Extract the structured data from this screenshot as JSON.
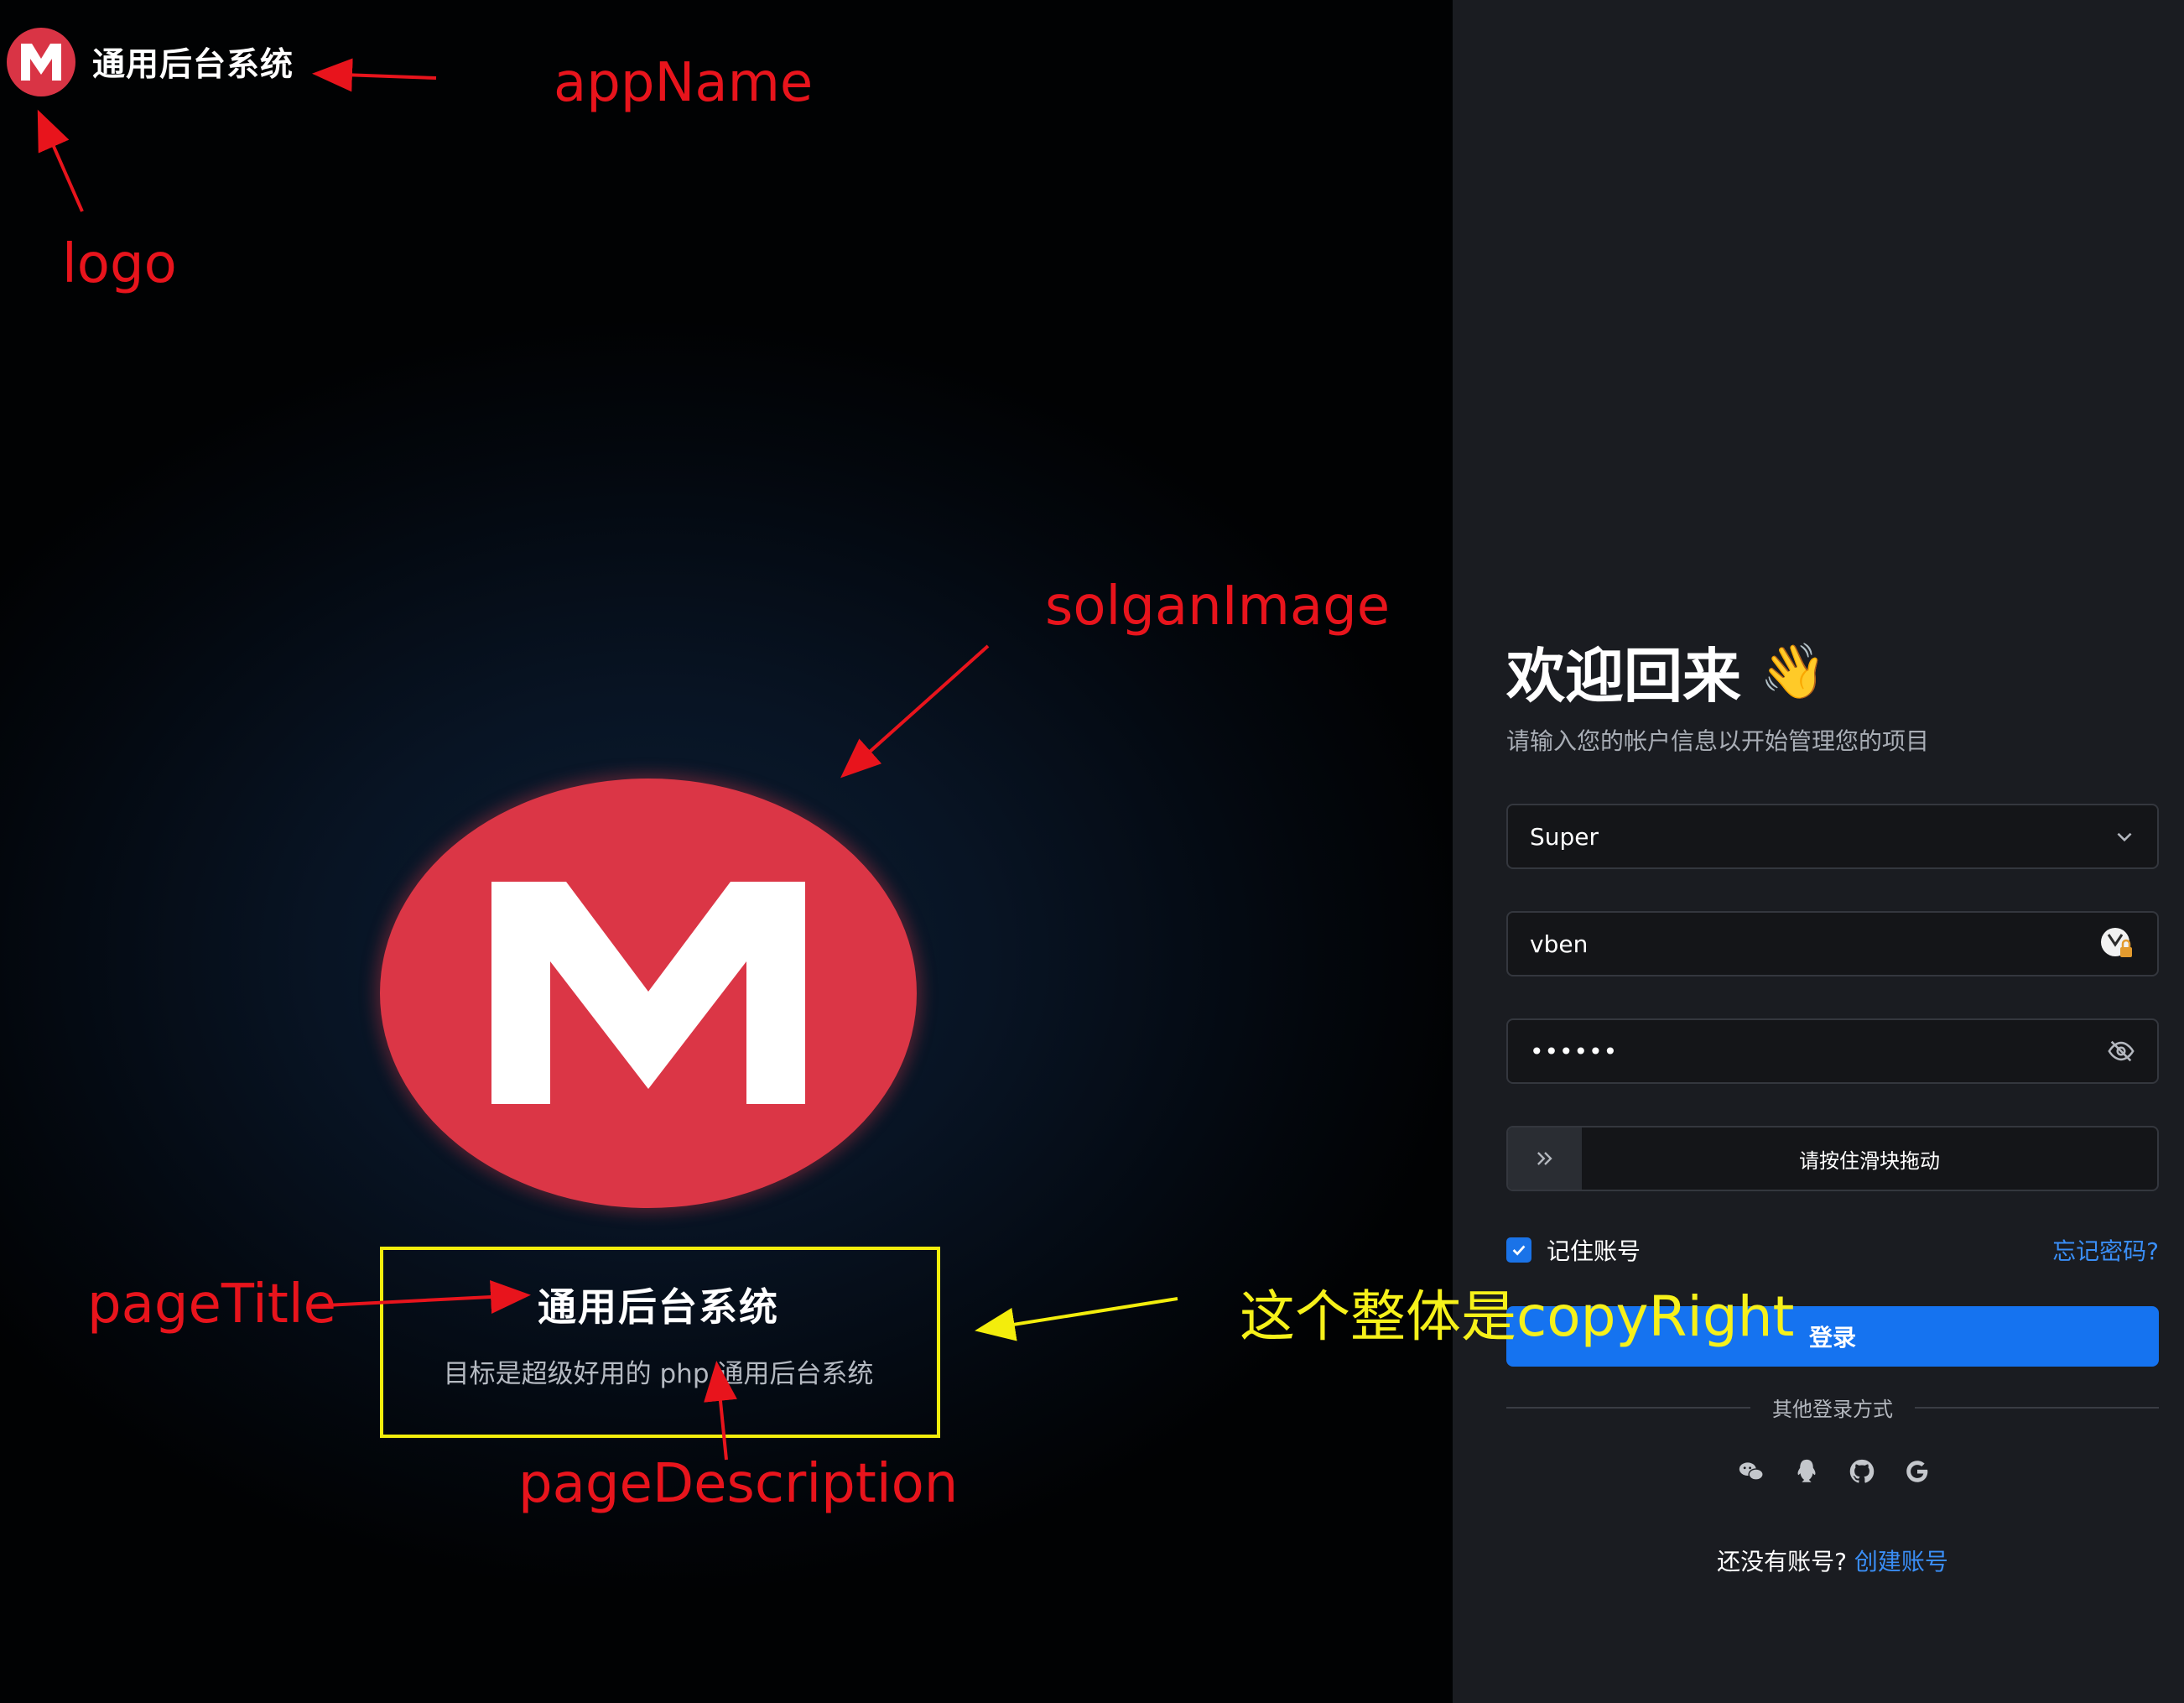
{
  "brand": {
    "logo_icon": "m-logo-icon",
    "logo_color": "#d93445",
    "app_name": "通用后台系统",
    "slogan_image_icon": "m-logo-large-icon",
    "page_title": "通用后台系统",
    "page_description": "目标是超级好用的 php 通用后台系统"
  },
  "annotations": {
    "app_name": "appName",
    "logo": "logo",
    "slogan_image": "solganImage",
    "page_title": "pageTitle",
    "page_description": "pageDescription",
    "copyright": "这个整体是copyRight",
    "red": "#e8141c",
    "yellow": "#f3ed0c"
  },
  "login": {
    "title": "欢迎回来",
    "title_emoji": "waving-hand-icon",
    "subtitle": "请输入您的帐户信息以开始管理您的项目",
    "account_select_value": "Super",
    "username_value": "vben",
    "password_value": "••••••",
    "slider_text": "请按住滑块拖动",
    "remember_label": "记住账号",
    "forgot_link": "忘记密码?",
    "login_button": "登录",
    "other_methods": "其他登录方式",
    "social_icons": [
      "wechat-icon",
      "qq-icon",
      "github-icon",
      "google-icon"
    ],
    "no_account_text": "还没有账号?",
    "create_account_link": "创建账号",
    "accent": "#1573f0"
  }
}
